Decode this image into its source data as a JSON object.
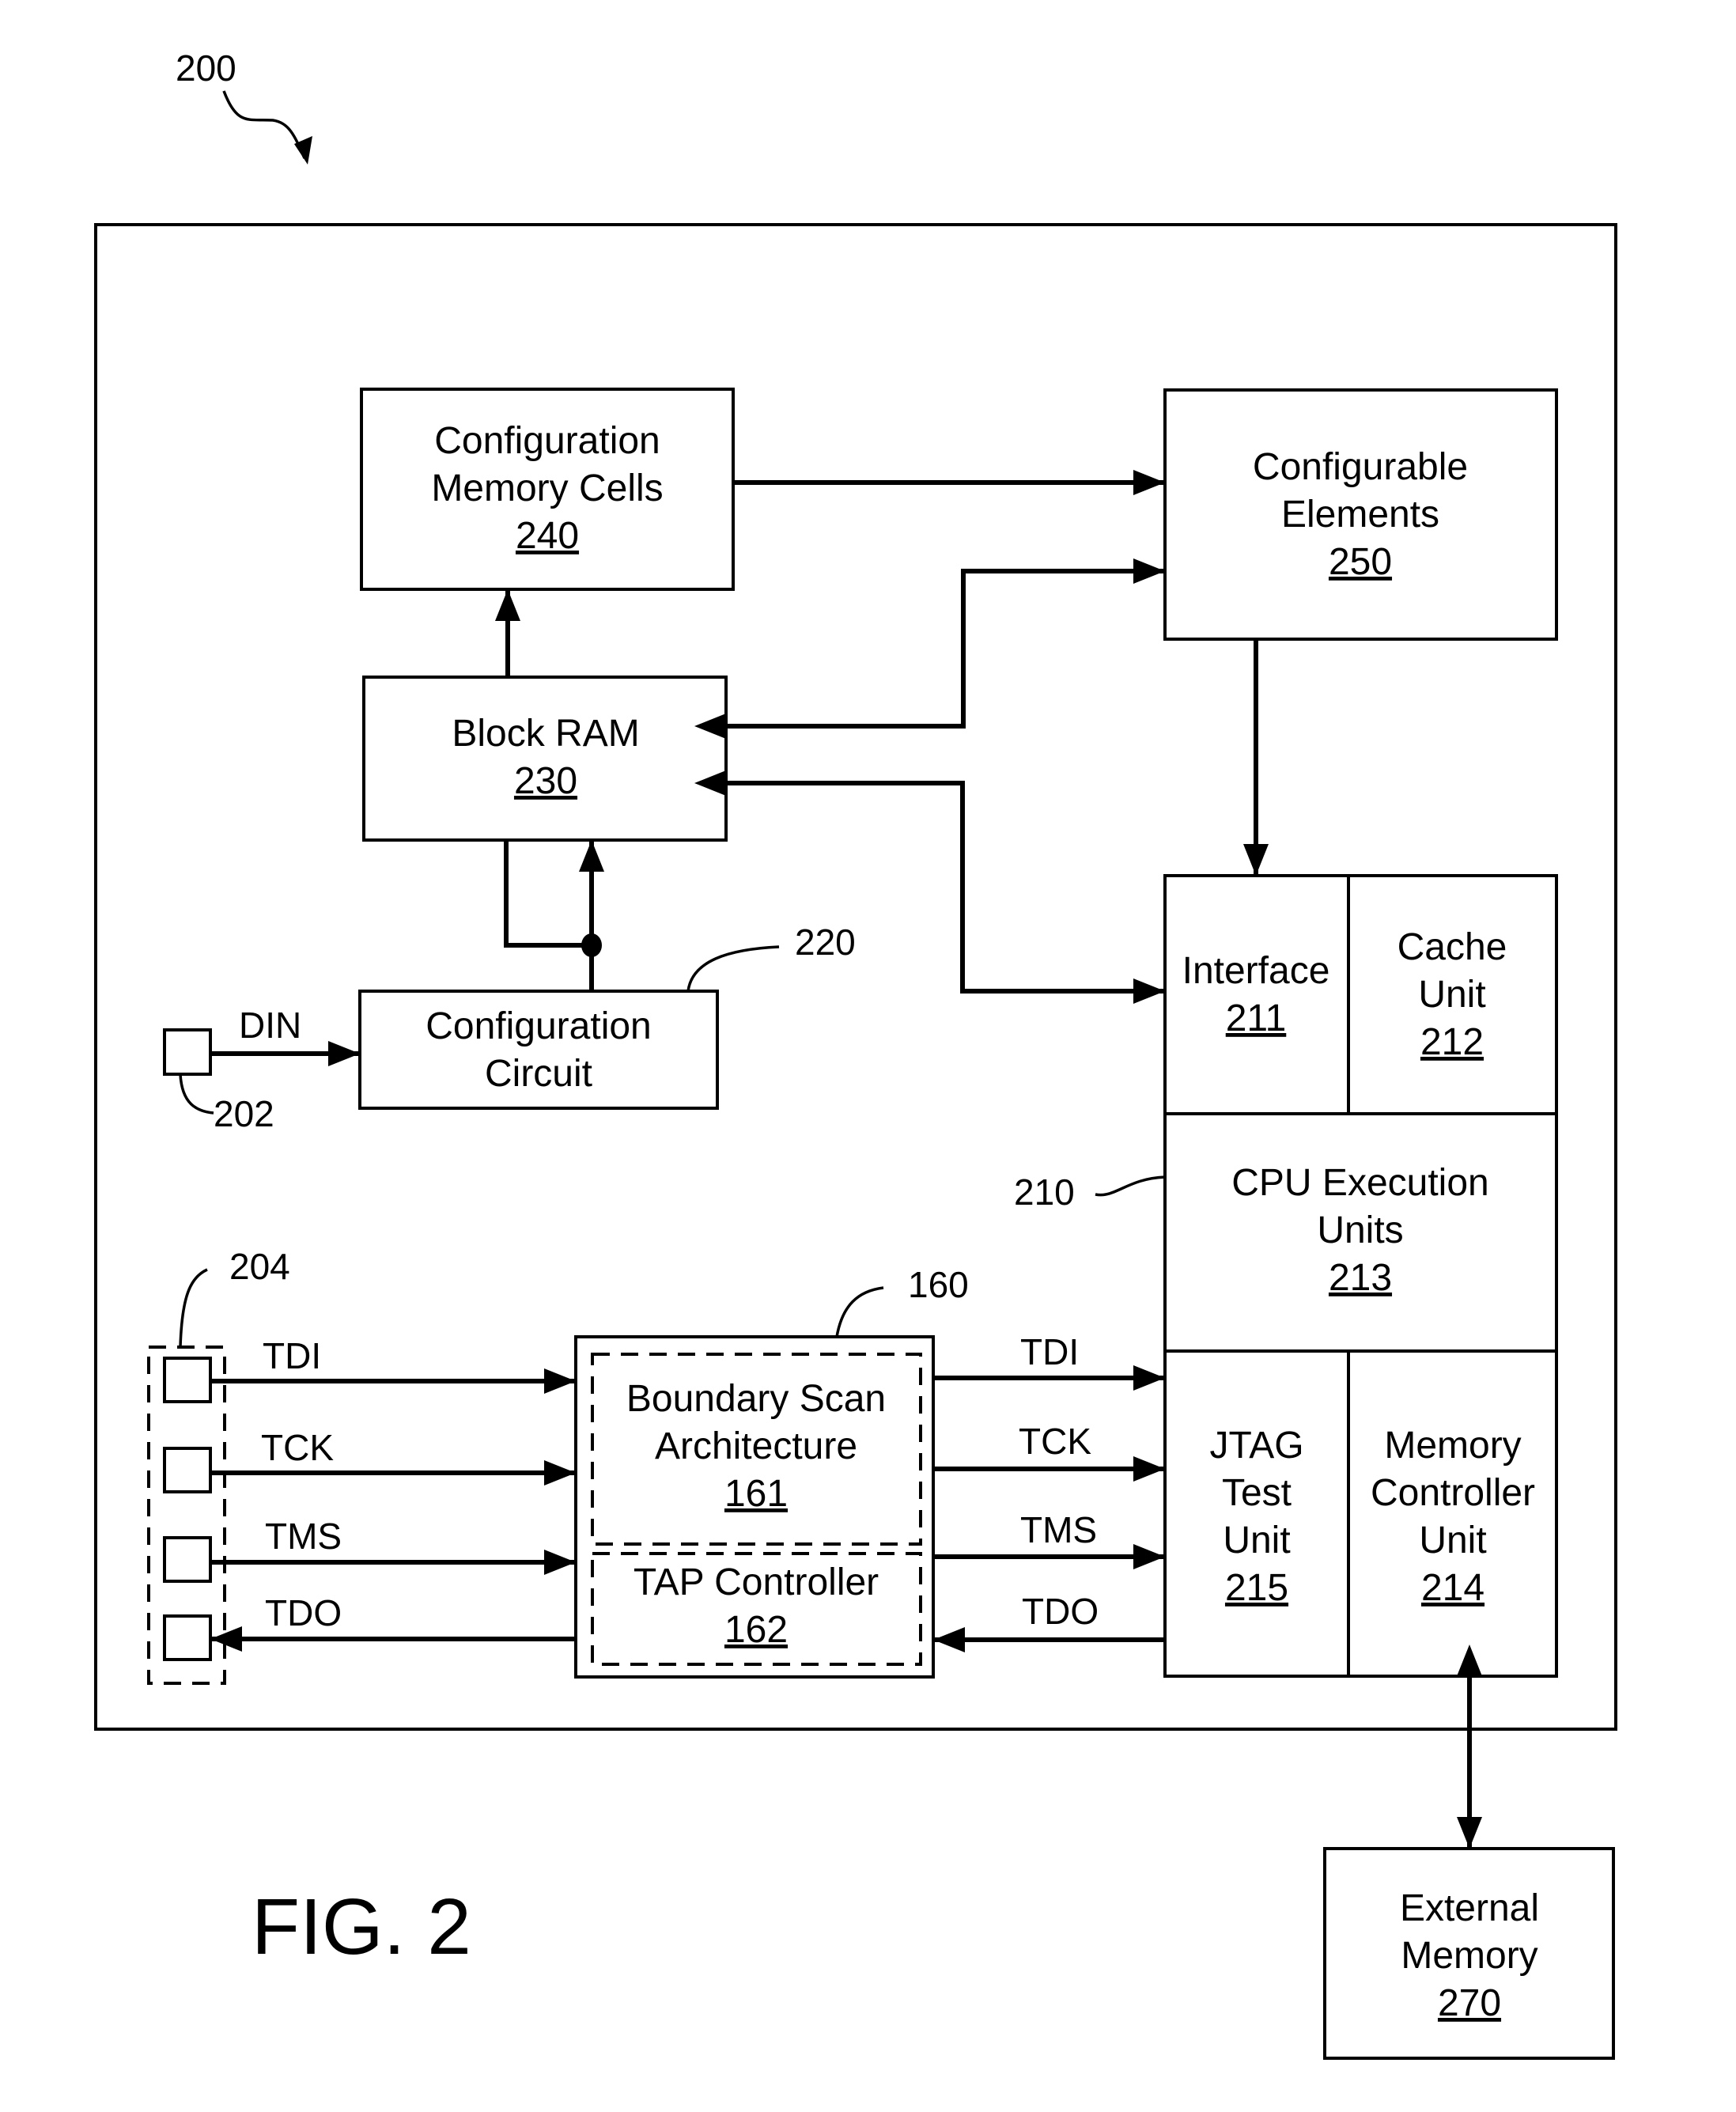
{
  "figure": {
    "label": "FIG. 2",
    "ref": "200"
  },
  "blocks": {
    "config_memory": {
      "line1": "Configuration",
      "line2": "Memory Cells",
      "ref": "240"
    },
    "configurable": {
      "line1": "Configurable",
      "line2": "Elements",
      "ref": "250"
    },
    "block_ram": {
      "line1": "Block RAM",
      "ref": "230"
    },
    "config_circuit": {
      "line1": "Configuration",
      "line2": "Circuit",
      "ref_callout": "220"
    },
    "interface": {
      "line1": "Interface",
      "ref": "211"
    },
    "cache": {
      "line1": "Cache",
      "line2": "Unit",
      "ref": "212"
    },
    "cpu_exec": {
      "line1": "CPU Execution",
      "line2": "Units",
      "ref": "213"
    },
    "jtag": {
      "line1": "JTAG",
      "line2": "Test",
      "line3": "Unit",
      "ref": "215"
    },
    "mem_ctrl": {
      "line1": "Memory",
      "line2": "Controller",
      "line3": "Unit",
      "ref": "214"
    },
    "boundary_scan": {
      "line1": "Boundary Scan",
      "line2": "Architecture",
      "ref": "161"
    },
    "tap": {
      "line1": "TAP Controller",
      "ref": "162"
    },
    "external_memory": {
      "line1": "External",
      "line2": "Memory",
      "ref": "270"
    }
  },
  "callouts": {
    "processor": "210",
    "jtag_block": "160",
    "jtag_pins": "204",
    "din_pin": "202"
  },
  "signals": {
    "din": "DIN",
    "left": [
      "TDI",
      "TCK",
      "TMS",
      "TDO"
    ],
    "right": [
      "TDI",
      "TCK",
      "TMS",
      "TDO"
    ]
  }
}
